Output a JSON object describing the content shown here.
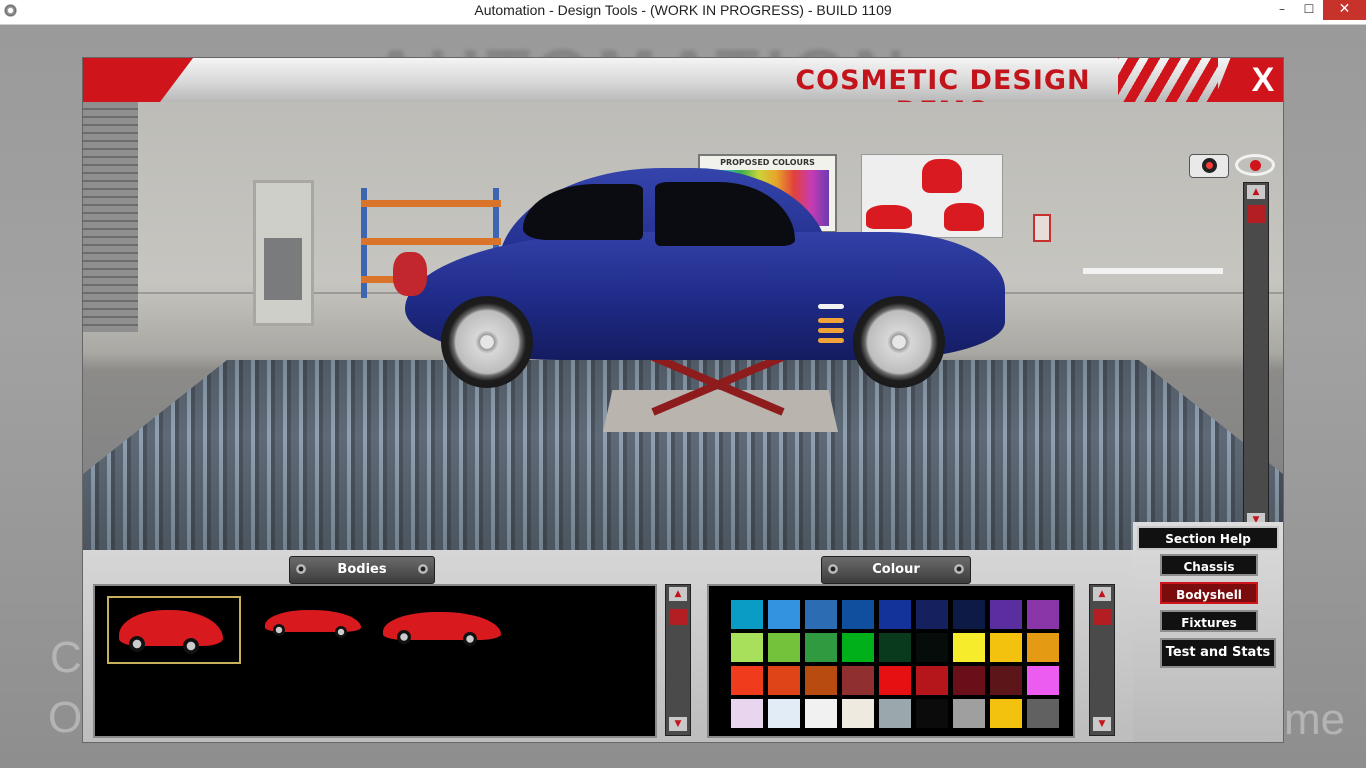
{
  "window": {
    "title": "Automation - Design Tools - (WORK IN PROGRESS) - BUILD 1109",
    "minimize": "–",
    "maximize": "☐",
    "close": "✕"
  },
  "backdrop": {
    "logo_text": "AUTOMATION",
    "left_letter_1": "C",
    "left_letter_2": "O",
    "right_text": "me"
  },
  "header": {
    "title": "COSMETIC DESIGN DEMO",
    "close_label": "X"
  },
  "scene": {
    "board_title": "PROPOSED COLOURS",
    "scroll_up": "▲",
    "scroll_down": "▼",
    "reset_view": "⤧"
  },
  "bodies": {
    "label": "Bodies",
    "items": [
      {
        "name": "hatchback",
        "selected": true
      },
      {
        "name": "sedan",
        "selected": false
      },
      {
        "name": "coupe",
        "selected": false
      }
    ],
    "scroll_up": "▲",
    "scroll_down": "▼"
  },
  "colour": {
    "label": "Colour",
    "scroll_up": "▲",
    "scroll_down": "▼",
    "swatches": [
      [
        "#0a9cc4",
        "#3393e0",
        "#2b6cb3",
        "#0f4f9e",
        "#13329a",
        "#15205e",
        "#0c1a45",
        "#5b2ea0",
        "#8a35a8"
      ],
      [
        "#a9e05b",
        "#74c13b",
        "#2f9a3f",
        "#00b01a",
        "#0a3a1e",
        "#060c09",
        "#f6ec2c",
        "#f3c20f",
        "#e59a13"
      ],
      [
        "#f03c1c",
        "#df4418",
        "#b84c10",
        "#8f2f2f",
        "#e60f12",
        "#b5161b",
        "#6a0f1a",
        "#5c1518",
        "#ec5cf0"
      ],
      [
        "#e9d5ee",
        "#e1ecf6",
        "#f1f1f1",
        "#efeadf",
        "#9aa7ad",
        "#0b0b0b",
        "#9f9f9f",
        "#f3c20f",
        "#616161"
      ]
    ]
  },
  "section": {
    "help": "Section Help",
    "chassis": "Chassis",
    "bodyshell": "Bodyshell",
    "fixtures": "Fixtures",
    "test_and_stats": "Test and Stats"
  }
}
